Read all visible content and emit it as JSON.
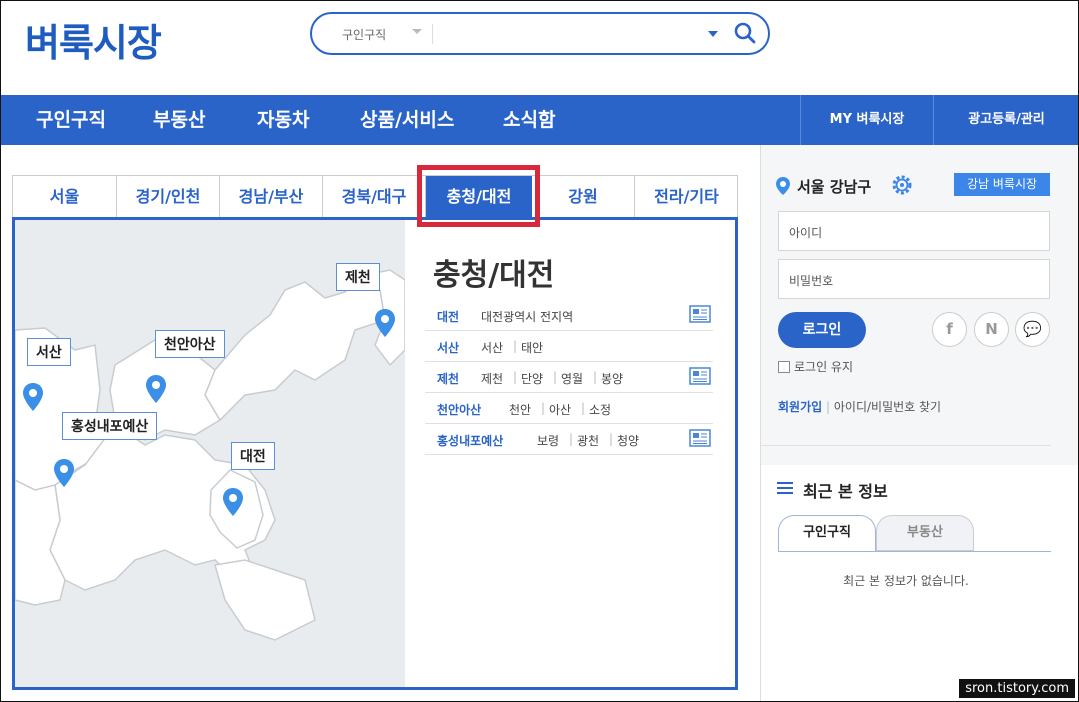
{
  "header": {
    "logo": "벼룩시장",
    "search": {
      "category": "구인구직",
      "value": ""
    }
  },
  "nav": {
    "items": [
      "구인구직",
      "부동산",
      "자동차",
      "상품/서비스",
      "소식함"
    ],
    "right": [
      "MY 벼룩시장",
      "광고등록/관리"
    ]
  },
  "region_tabs": [
    "서울",
    "경기/인천",
    "경남/부산",
    "경북/대구",
    "충청/대전",
    "강원",
    "전라/기타"
  ],
  "active_tab": "충청/대전",
  "map": {
    "labels": [
      "제천",
      "서산",
      "천안아산",
      "홍성내포예산",
      "대전"
    ]
  },
  "region_panel": {
    "title": "충청/대전",
    "rows": [
      {
        "name": "대전",
        "subs": [
          "대전광역시 전지역"
        ]
      },
      {
        "name": "서산",
        "subs": [
          "서산",
          "태안"
        ]
      },
      {
        "name": "제천",
        "subs": [
          "제천",
          "단양",
          "영월",
          "봉양"
        ]
      },
      {
        "name": "천안아산",
        "subs": [
          "천안",
          "아산",
          "소정"
        ]
      },
      {
        "name": "홍성내포예산",
        "subs": [
          "보령",
          "광천",
          "청양"
        ]
      }
    ]
  },
  "sidebar": {
    "location": "서울 강남구",
    "local_button": "강남 벼룩시장",
    "id_placeholder": "아이디",
    "pw_placeholder": "비밀번호",
    "login": "로그인",
    "sns": [
      "f",
      "N",
      "💬"
    ],
    "keep_login": "로그인 유지",
    "join": "회원가입",
    "find": "아이디/비밀번호 찾기",
    "recent_title": "최근 본 정보",
    "recent_tabs": [
      "구인구직",
      "부동산"
    ],
    "recent_empty": "최근 본 정보가 없습니다."
  },
  "watermark": "sron.tistory.com",
  "colors": {
    "brand": "#2a64c8",
    "highlight": "#d8283c",
    "marker": "#3b8fe6"
  }
}
